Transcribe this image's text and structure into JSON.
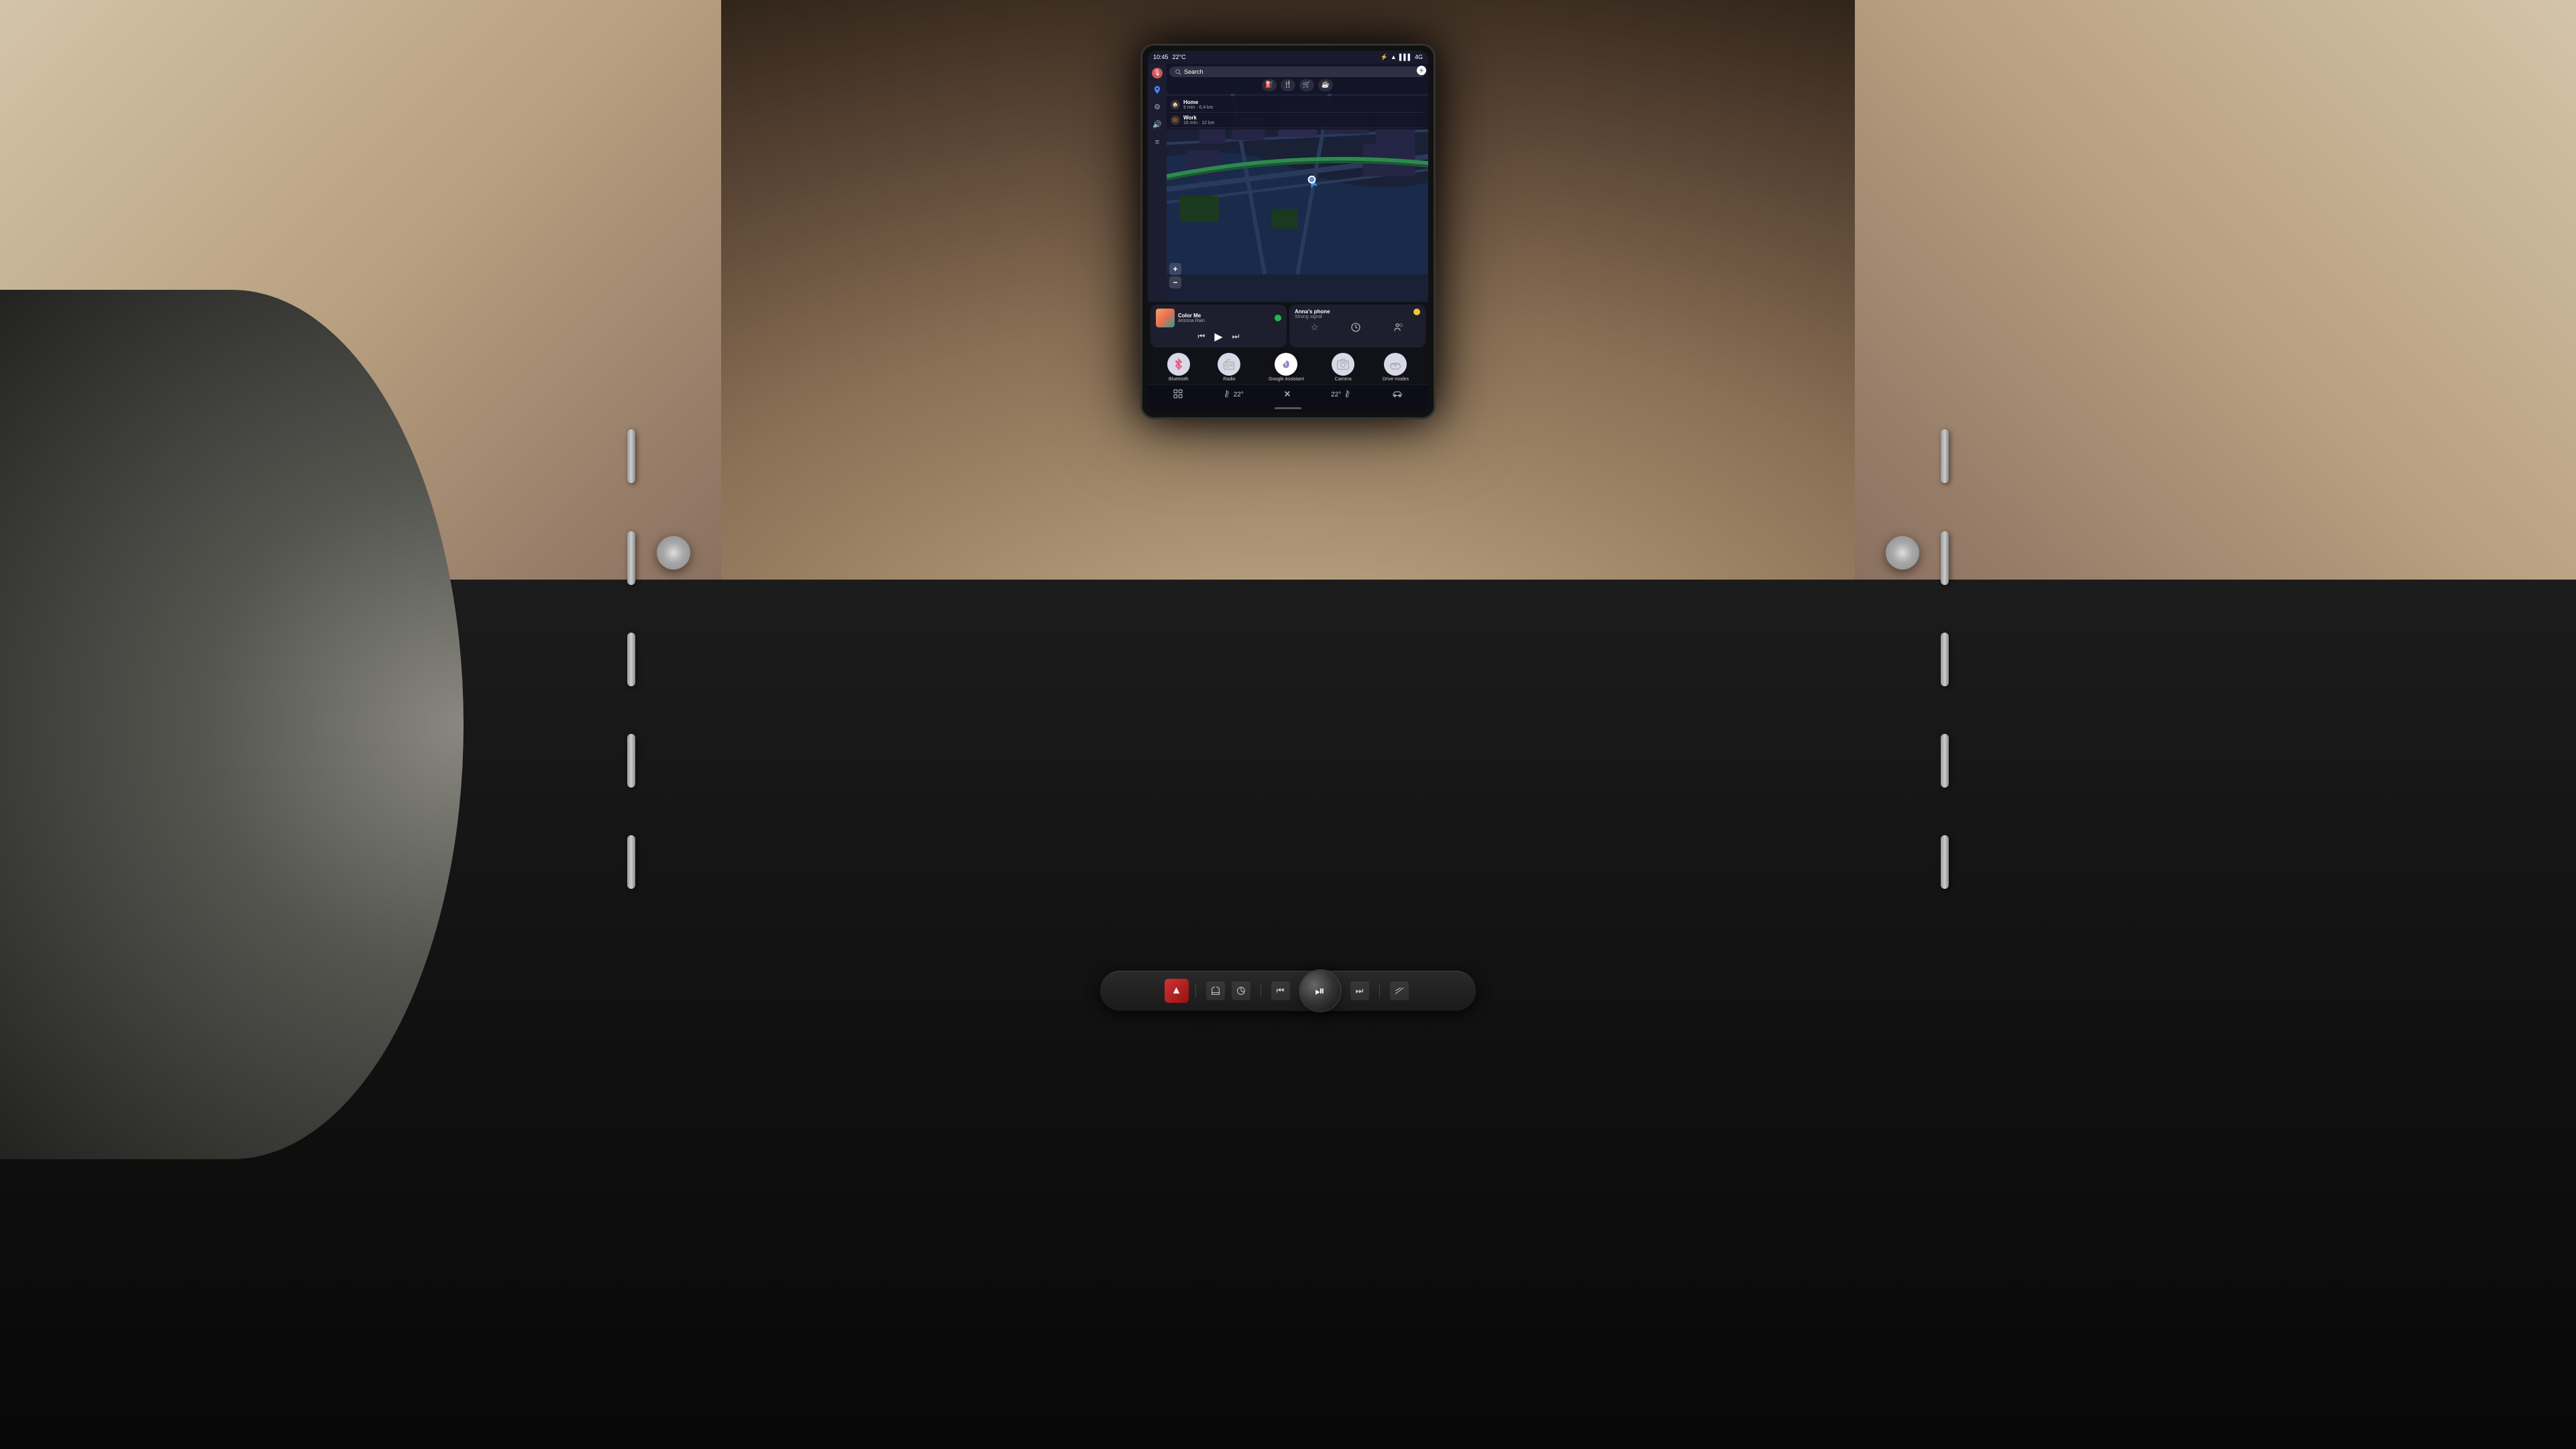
{
  "car": {
    "background_color": "#8a7060"
  },
  "statusBar": {
    "time": "10:45",
    "temperature": "22°C",
    "bluetooth_icon": "⚡",
    "signal_bars": "▌▌▌",
    "network": "4G",
    "wifi_icon": "◈"
  },
  "map": {
    "search_placeholder": "Search",
    "search_icon": "🔍",
    "categories": [
      {
        "label": "gas",
        "icon": "⛽"
      },
      {
        "label": "food",
        "icon": "🍴"
      },
      {
        "label": "shop",
        "icon": "🛒"
      },
      {
        "label": "cafe",
        "icon": "☕"
      }
    ],
    "destinations": [
      {
        "name": "Home",
        "time": "9 min",
        "distance": "6.4 km"
      },
      {
        "name": "Work",
        "time": "16 min",
        "distance": "12 km"
      }
    ],
    "zoom_in": "+",
    "zoom_out": "−"
  },
  "musicWidget": {
    "title": "Color Me",
    "artist": "Arizona Rain",
    "service": "spotify",
    "controls": {
      "prev": "⏮",
      "play": "▶",
      "next": "⏭"
    }
  },
  "phoneWidget": {
    "device_name": "Anna's phone",
    "signal": "Strong signal",
    "actions": {
      "favorite": "☆",
      "recent": "⏱",
      "contacts": "👥"
    }
  },
  "apps": [
    {
      "id": "bluetooth",
      "label": "Bluetooth",
      "icon": "⚡",
      "bg": "#e8e8f0"
    },
    {
      "id": "radio",
      "label": "Radio",
      "icon": "📻",
      "bg": "#e8e8f0"
    },
    {
      "id": "google-assistant",
      "label": "Google Assistant",
      "icon": "🎙",
      "bg": "#fff"
    },
    {
      "id": "camera",
      "label": "Camera",
      "icon": "📷",
      "bg": "#e8e8f0"
    },
    {
      "id": "drive-modes",
      "label": "Drive modes",
      "icon": "🚗",
      "bg": "#e8e8f0"
    }
  ],
  "bottomBar": {
    "items": [
      {
        "id": "apps-grid",
        "icon": "⊞",
        "label": ""
      },
      {
        "id": "temp-left",
        "icon": "🌡",
        "value": "22°",
        "label": "22°"
      },
      {
        "id": "fan",
        "icon": "❋",
        "label": ""
      },
      {
        "id": "temp-right",
        "icon": "🌡",
        "value": "22°",
        "label": "22°"
      },
      {
        "id": "car",
        "icon": "🚗",
        "label": ""
      }
    ]
  },
  "physicalControls": {
    "hazard": "▲",
    "heated_seats": "≋",
    "heated_wheel": "◎",
    "prev_track": "⏮",
    "play_pause": "⏯",
    "next_track": "⏭",
    "mode": "≡"
  }
}
